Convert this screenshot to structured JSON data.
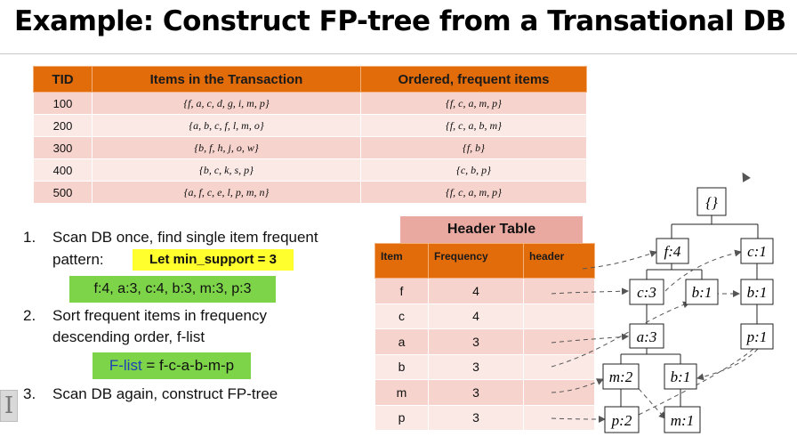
{
  "title": "Example: Construct FP-tree from a Transational DB",
  "transactions": {
    "headers": [
      "TID",
      "Items in the Transaction",
      "Ordered, frequent items"
    ],
    "rows": [
      {
        "tid": "100",
        "items": "{f, a, c, d, g, i, m, p}",
        "ordered": "{f, c, a, m, p}"
      },
      {
        "tid": "200",
        "items": "{a, b, c, f, l, m, o}",
        "ordered": "{f, c, a, b, m}"
      },
      {
        "tid": "300",
        "items": "{b, f, h, j, o, w}",
        "ordered": "{f, b}"
      },
      {
        "tid": "400",
        "items": "{b, c, k, s, p}",
        "ordered": "{c, b, p}"
      },
      {
        "tid": "500",
        "items": "{a, f, c, e, l, p, m, n}",
        "ordered": "{f, c, a, m, p}"
      }
    ]
  },
  "steps": {
    "s1_num": "1.",
    "s1_line1": "Scan DB once, find single item frequent",
    "s1_line2": "pattern:",
    "min_support": "Let min_support = 3",
    "frequent_items": "f:4, a:3, c:4, b:3, m:3, p:3",
    "s2_num": "2.",
    "s2_line1": "Sort frequent items in frequency",
    "s2_line2": "descending order, f-list",
    "flist_key": "F-list",
    "flist_value": " = f-c-a-b-m-p",
    "s3_num": "3.",
    "s3_line1": "Scan DB again, construct FP-tree"
  },
  "header_table": {
    "title": "Header Table",
    "columns": [
      "Item",
      "Frequency",
      "header"
    ],
    "rows": [
      {
        "item": "f",
        "frequency": "4"
      },
      {
        "item": "c",
        "frequency": "4"
      },
      {
        "item": "a",
        "frequency": "3"
      },
      {
        "item": "b",
        "frequency": "3"
      },
      {
        "item": "m",
        "frequency": "3"
      },
      {
        "item": "p",
        "frequency": "3"
      }
    ]
  },
  "fp_tree": {
    "root": "{}",
    "nodes": [
      "f:4",
      "c:1",
      "c:3",
      "b:1",
      "b:1",
      "a:3",
      "p:1",
      "m:2",
      "b:1",
      "p:2",
      "m:1"
    ]
  },
  "icons": {
    "text_cursor": "I"
  },
  "colors": {
    "accent": "#e36c0a",
    "row_dark": "#f6d3cc",
    "row_light": "#fbe9e6",
    "highlight_yellow": "#ffff2e",
    "highlight_green": "#7dd449"
  }
}
